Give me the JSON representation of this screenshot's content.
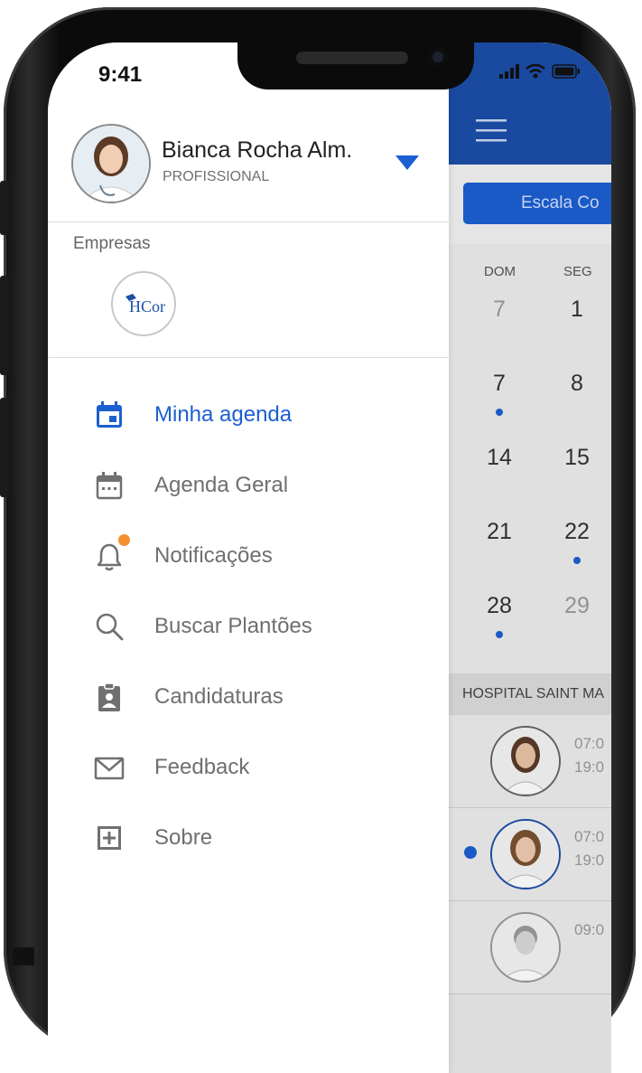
{
  "status_bar": {
    "time": "9:41"
  },
  "profile": {
    "name": "Bianca Rocha Alm.",
    "role": "PROFISSIONAL"
  },
  "companies": {
    "label": "Empresas",
    "logo_text": "HCor"
  },
  "menu": {
    "items": [
      {
        "label": "Minha agenda",
        "icon": "calendar-icon",
        "active": true
      },
      {
        "label": "Agenda Geral",
        "icon": "calendar-grid-icon",
        "active": false
      },
      {
        "label": "Notificações",
        "icon": "bell-icon",
        "active": false,
        "badge": true
      },
      {
        "label": "Buscar Plantões",
        "icon": "search-icon",
        "active": false
      },
      {
        "label": "Candidaturas",
        "icon": "clipboard-user-icon",
        "active": false
      },
      {
        "label": "Feedback",
        "icon": "mail-icon",
        "active": false
      },
      {
        "label": "Sobre",
        "icon": "plus-box-icon",
        "active": false
      }
    ]
  },
  "background_app": {
    "tab_label": "Escala Co",
    "weekdays": [
      "DOM",
      "SEG"
    ],
    "weeks": [
      {
        "days": [
          "7",
          "1"
        ]
      },
      {
        "days": [
          "7",
          "8"
        ]
      },
      {
        "days": [
          "14",
          "15"
        ]
      },
      {
        "days": [
          "21",
          "22"
        ]
      },
      {
        "days": [
          "28",
          "29"
        ]
      }
    ],
    "section_title": "HOSPITAL SAINT MA",
    "shifts": [
      {
        "start": "07:0",
        "end": "19:0"
      },
      {
        "start": "07:0",
        "end": "19:0"
      },
      {
        "start": "09:0",
        "end": ""
      }
    ]
  },
  "colors": {
    "accent": "#1c5fd1",
    "header": "#1c4fa8",
    "badge": "#f5902e"
  }
}
